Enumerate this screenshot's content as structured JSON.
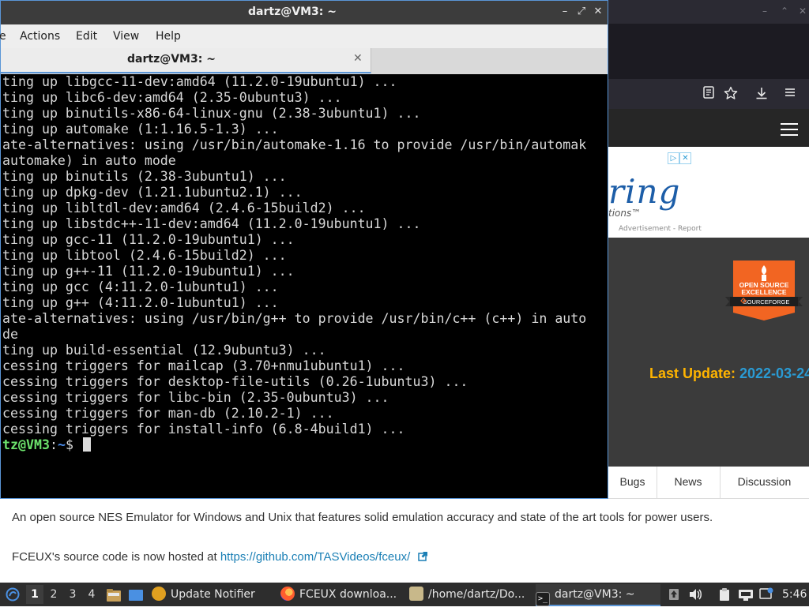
{
  "browser": {
    "window_controls": {
      "minimize": "–",
      "restore": "⌃",
      "close": "✕"
    },
    "site": {
      "ad": {
        "logo_text": "ring",
        "tagline": "tions™",
        "report_text": "Advertisement - Report",
        "adchoices": [
          "▷",
          "✕"
        ]
      },
      "badge": {
        "line1": "OPEN SOURCE",
        "line2": "EXCELLENCE",
        "brand": "SOURCEFORGE"
      },
      "last_update_label": "Last Update: ",
      "last_update_date": "2022-03-24",
      "tabs": [
        "Bugs",
        "News",
        "Discussion"
      ],
      "description": "An open source NES Emulator for Windows and Unix that features solid emulation accuracy and state of the art tools for power users.",
      "source_prefix": "FCEUX's source code is now hosted at ",
      "source_link": "https://github.com/TASVideos/fceux/"
    },
    "colors": {
      "accent_link": "#1a7fb5",
      "last_update": "#ffb400",
      "badge": "#f26522"
    }
  },
  "terminal": {
    "title": "dartz@VM3: ~",
    "window_controls": {
      "minimize": "–",
      "maximize": "⤢",
      "close": "✕"
    },
    "menu": [
      "e",
      "Actions",
      "Edit",
      "View",
      "Help"
    ],
    "tab_title": "dartz@VM3: ~",
    "tab_close": "✕",
    "lines": [
      "ting up libgcc-11-dev:amd64 (11.2.0-19ubuntu1) ...",
      "ting up libc6-dev:amd64 (2.35-0ubuntu3) ...",
      "ting up binutils-x86-64-linux-gnu (2.38-3ubuntu1) ...",
      "ting up automake (1:1.16.5-1.3) ...",
      "ate-alternatives: using /usr/bin/automake-1.16 to provide /usr/bin/automak",
      "automake) in auto mode",
      "ting up binutils (2.38-3ubuntu1) ...",
      "ting up dpkg-dev (1.21.1ubuntu2.1) ...",
      "ting up libltdl-dev:amd64 (2.4.6-15build2) ...",
      "ting up libstdc++-11-dev:amd64 (11.2.0-19ubuntu1) ...",
      "ting up gcc-11 (11.2.0-19ubuntu1) ...",
      "ting up libtool (2.4.6-15build2) ...",
      "ting up g++-11 (11.2.0-19ubuntu1) ...",
      "ting up gcc (4:11.2.0-1ubuntu1) ...",
      "ting up g++ (4:11.2.0-1ubuntu1) ...",
      "ate-alternatives: using /usr/bin/g++ to provide /usr/bin/c++ (c++) in auto",
      "de",
      "ting up build-essential (12.9ubuntu3) ...",
      "cessing triggers for mailcap (3.70+nmu1ubuntu1) ...",
      "cessing triggers for desktop-file-utils (0.26-1ubuntu3) ...",
      "cessing triggers for libc-bin (2.35-0ubuntu3) ...",
      "cessing triggers for man-db (2.10.2-1) ...",
      "cessing triggers for install-info (6.8-4build1) ..."
    ],
    "prompt": {
      "user": "tz@VM3",
      "sep": ":",
      "path": "~",
      "symbol": "$ "
    }
  },
  "taskbar": {
    "workspaces": [
      "1",
      "2",
      "3",
      "4"
    ],
    "active_workspace": "1",
    "tasks": [
      {
        "label": "Update Notifier",
        "icon": "update-notifier-icon"
      },
      {
        "label": "FCEUX downloa...",
        "icon": "firefox-icon"
      },
      {
        "label": "/home/dartz/Do...",
        "icon": "file-manager-icon"
      },
      {
        "label": "dartz@VM3: ~",
        "icon": "terminal-icon"
      }
    ],
    "clock": "5:46",
    "colors": {
      "bar": "#2d2d2d",
      "active_underline": "#5a95d6"
    }
  }
}
